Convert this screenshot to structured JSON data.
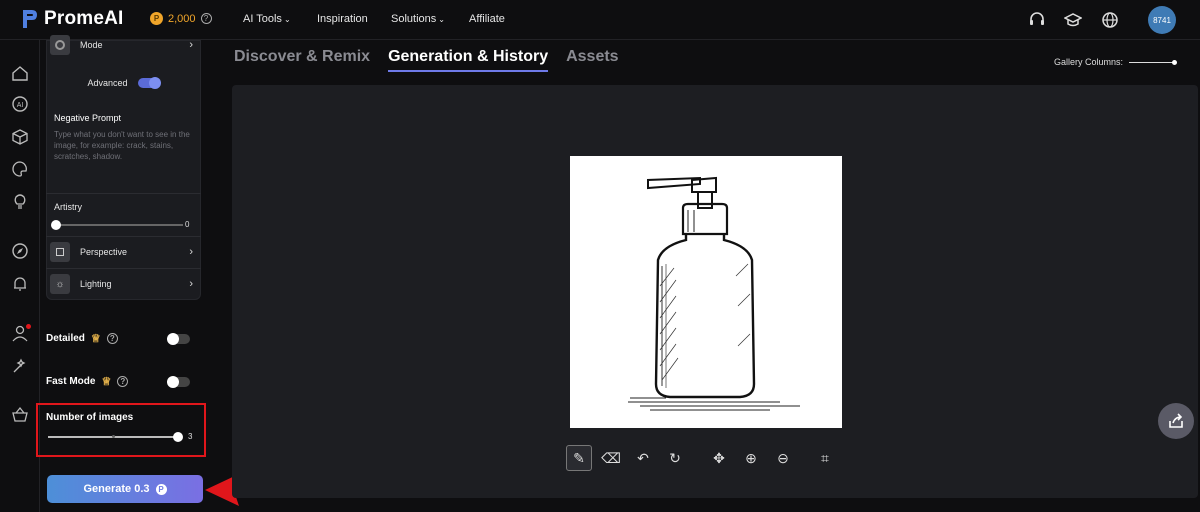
{
  "header": {
    "brand": "PromeAI",
    "credits": "2,000",
    "help_glyph": "?",
    "nav": [
      {
        "label": "AI Tools",
        "has_dropdown": true
      },
      {
        "label": "Inspiration",
        "has_dropdown": false
      },
      {
        "label": "Solutions",
        "has_dropdown": true
      },
      {
        "label": "Affiliate",
        "has_dropdown": false
      }
    ],
    "right_icons": [
      "headset-icon",
      "graduation-cap-icon",
      "globe-icon"
    ],
    "avatar": "8741"
  },
  "rail": {
    "icons": [
      "home-icon",
      "ai-icon",
      "cube-icon",
      "palette-icon",
      "lightbulb-icon",
      "compass-icon",
      "bell-icon",
      "user-icon",
      "magic-wand-icon",
      "basket-icon"
    ]
  },
  "panel": {
    "mode_label": "Mode",
    "advanced_label": "Advanced",
    "advanced_on": true,
    "negative_prompt_title": "Negative Prompt",
    "negative_prompt_placeholder": "Type what you don't want to see in the image, for example: crack, stains, scratches, shadow.",
    "artistry_label": "Artistry",
    "artistry_value": "0",
    "perspective_label": "Perspective",
    "lighting_label": "Lighting",
    "detailed_label": "Detailed",
    "detailed_on": false,
    "fast_mode_label": "Fast Mode",
    "fast_mode_on": false,
    "num_images_label": "Number of images",
    "num_images_value": "3",
    "generate_label": "Generate 0.3",
    "generate_coin": "P"
  },
  "main": {
    "tabs": [
      {
        "label": "Discover & Remix",
        "active": false
      },
      {
        "label": "Generation & History",
        "active": true
      },
      {
        "label": "Assets",
        "active": false
      }
    ],
    "gallery_columns_label": "Gallery Columns:",
    "toolbar": [
      "brush-icon",
      "eraser-icon",
      "undo-icon",
      "redo-icon",
      "move-icon",
      "zoom-in-icon",
      "zoom-out-icon",
      "crop-icon"
    ]
  },
  "colors": {
    "accent": "#6e7ae8",
    "credit": "#f0a52a",
    "annotation_red": "#e0161b"
  }
}
